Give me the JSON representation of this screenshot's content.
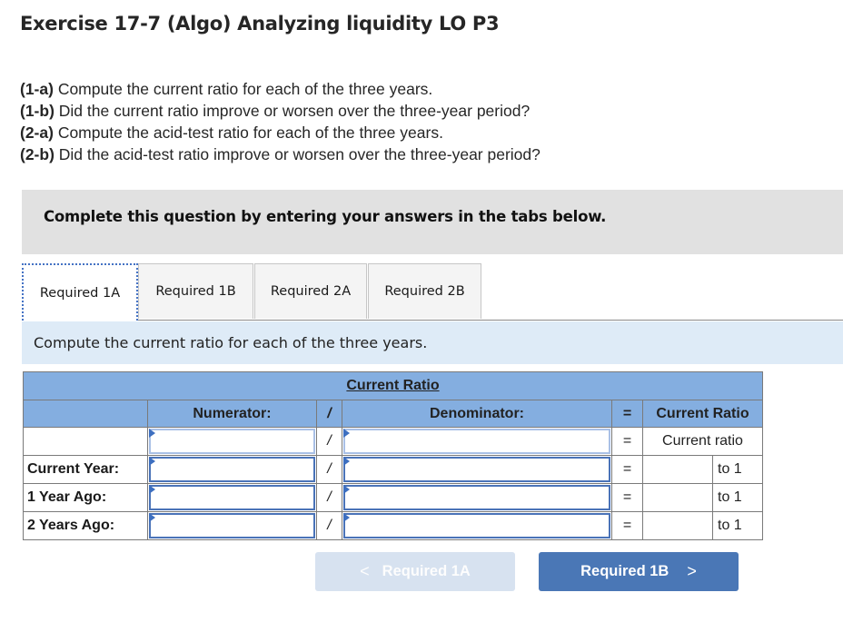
{
  "title": "Exercise 17-7 (Algo) Analyzing liquidity LO P3",
  "questions": [
    {
      "tag": "(1-a)",
      "text": " Compute the current ratio for each of the three years."
    },
    {
      "tag": "(1-b)",
      "text": " Did the current ratio improve or worsen over the three-year period?"
    },
    {
      "tag": "(2-a)",
      "text": " Compute the acid-test ratio for each of the three years."
    },
    {
      "tag": "(2-b)",
      "text": " Did the acid-test ratio improve or worsen over the three-year period?"
    }
  ],
  "banner": "Complete this question by entering your answers in the tabs below.",
  "tabs": [
    {
      "label": "Required 1A",
      "active": true
    },
    {
      "label": "Required 1B",
      "active": false
    },
    {
      "label": "Required 2A",
      "active": false
    },
    {
      "label": "Required 2B",
      "active": false
    }
  ],
  "instruction": "Compute the current ratio for each of the three years.",
  "table": {
    "caption": "Current Ratio",
    "headers": {
      "numerator": "Numerator:",
      "slash": "/",
      "denominator": "Denominator:",
      "equals": "=",
      "result": "Current Ratio"
    },
    "unit_row": {
      "slash": "/",
      "equals": "=",
      "result": "Current ratio",
      "numerator_value": "",
      "denominator_value": ""
    },
    "rows": [
      {
        "label": "Current Year:",
        "numerator_value": "",
        "slash": "/",
        "denominator_value": "",
        "equals": "=",
        "ratio_value": "",
        "suffix": "to 1"
      },
      {
        "label": "1 Year Ago:",
        "numerator_value": "",
        "slash": "/",
        "denominator_value": "",
        "equals": "=",
        "ratio_value": "",
        "suffix": "to 1"
      },
      {
        "label": "2 Years Ago:",
        "numerator_value": "",
        "slash": "/",
        "denominator_value": "",
        "equals": "=",
        "ratio_value": "",
        "suffix": "to 1"
      }
    ]
  },
  "nav": {
    "prev_label": "Required 1A",
    "prev_icon": "chevron-left-icon",
    "next_label": "Required 1B",
    "next_icon": "chevron-right-icon",
    "prev_glyph": "<",
    "next_glyph": ">"
  }
}
